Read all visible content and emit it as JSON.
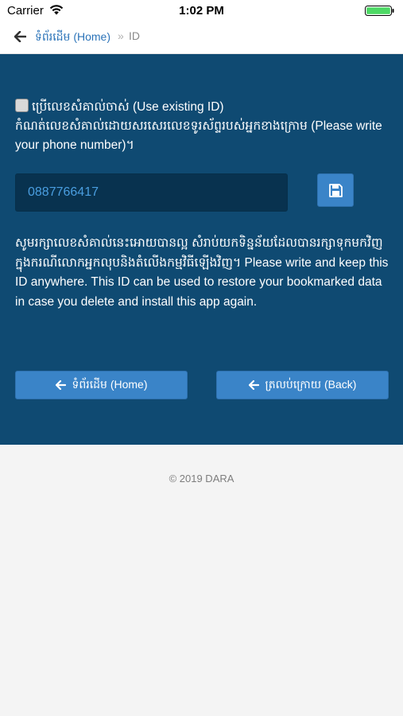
{
  "status_bar": {
    "carrier": "Carrier",
    "time": "1:02 PM",
    "icons": [
      "wifi-icon",
      "battery-icon"
    ],
    "battery_color": "#4cd964"
  },
  "nav": {
    "back_icon": "back-arrow-icon",
    "home_label": "ទំព័រដើម (Home)",
    "separator": "»",
    "current": "ID"
  },
  "form": {
    "use_existing_label": "ប្រើលេខសំគាល់ចាស់ (Use existing ID)",
    "use_existing_checked": false,
    "instruction": "កំណត់លេខសំគាល់ដោយសរសេរលេខទូរស័ព្ទរបស់អ្នកខាងក្រោម (Please write your phone number)។",
    "id_value": "0887766417",
    "save_icon": "floppy-disk-icon",
    "note": "សូមរក្សាលេខសំគាល់នេះអោយបានល្អ សំរាប់យកទិន្នន័យដែលបានរក្សាទុកមកវិញក្នុងករណីលោកអ្នកលុបនិងតំលើងកម្មវិធីឡើងវិញ។ Please write and keep this ID anywhere. This ID can be used to restore your bookmarked data in case you delete and install this app again."
  },
  "buttons": {
    "home_label": "ទំព័រដើម (Home)",
    "back_label": "ត្រលប់ក្រោយ (Back)"
  },
  "footer": {
    "copyright": "© 2019 DARA"
  },
  "colors": {
    "panel_bg": "#0f4a72",
    "input_bg": "#08324f",
    "button_bg": "#3a84c8",
    "link": "#2b73b8",
    "input_text": "#4a9ee0"
  }
}
